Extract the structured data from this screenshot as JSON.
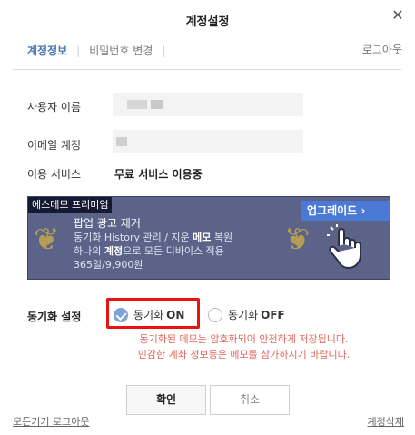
{
  "dialog": {
    "title": "계정설정",
    "close_glyph": "✕"
  },
  "tabs": {
    "items": [
      {
        "label": "계정정보"
      },
      {
        "label": "비밀번호 변경"
      }
    ],
    "separator": "|",
    "logout": "로그아웃"
  },
  "account": {
    "username_label": "사용자 이름",
    "email_label": "이메일 계정",
    "service_label": "이용 서비스",
    "service_value": "무료 서비스 이용중"
  },
  "banner": {
    "tag": "에스메모 프리미엄",
    "line1": "팝업 광고 제거",
    "line2_pre": "동기화 History 관리 / 지운 ",
    "line2_bold": "메모",
    "line2_post": " 복원",
    "line3_pre": "하나의 ",
    "line3_bold": "계정",
    "line3_post": "으로 모든 디바이스 적용",
    "line4": "365일/9,900원",
    "upgrade": "업그레이드 ›",
    "laurel_left": "❦",
    "laurel_right": "❦"
  },
  "sync": {
    "label": "동기화 설정",
    "on_text": "동기화",
    "on_state": "ON",
    "off_text": "동기화",
    "off_state": "OFF",
    "warning1": "동기화된 메모는 암호화되어 안전하게 저장됩니다.",
    "warning2": "민감한 계좌 정보등은 메모를 삼가하시기 바랍니다."
  },
  "buttons": {
    "confirm": "확인",
    "cancel": "취소"
  },
  "footer": {
    "logout_all": "모든기기 로그아웃",
    "delete": "계정삭제"
  },
  "colors": {
    "accent": "#4a78b6",
    "highlight": "#e11111",
    "warning": "#e0655a",
    "banner": "#5b6488"
  }
}
